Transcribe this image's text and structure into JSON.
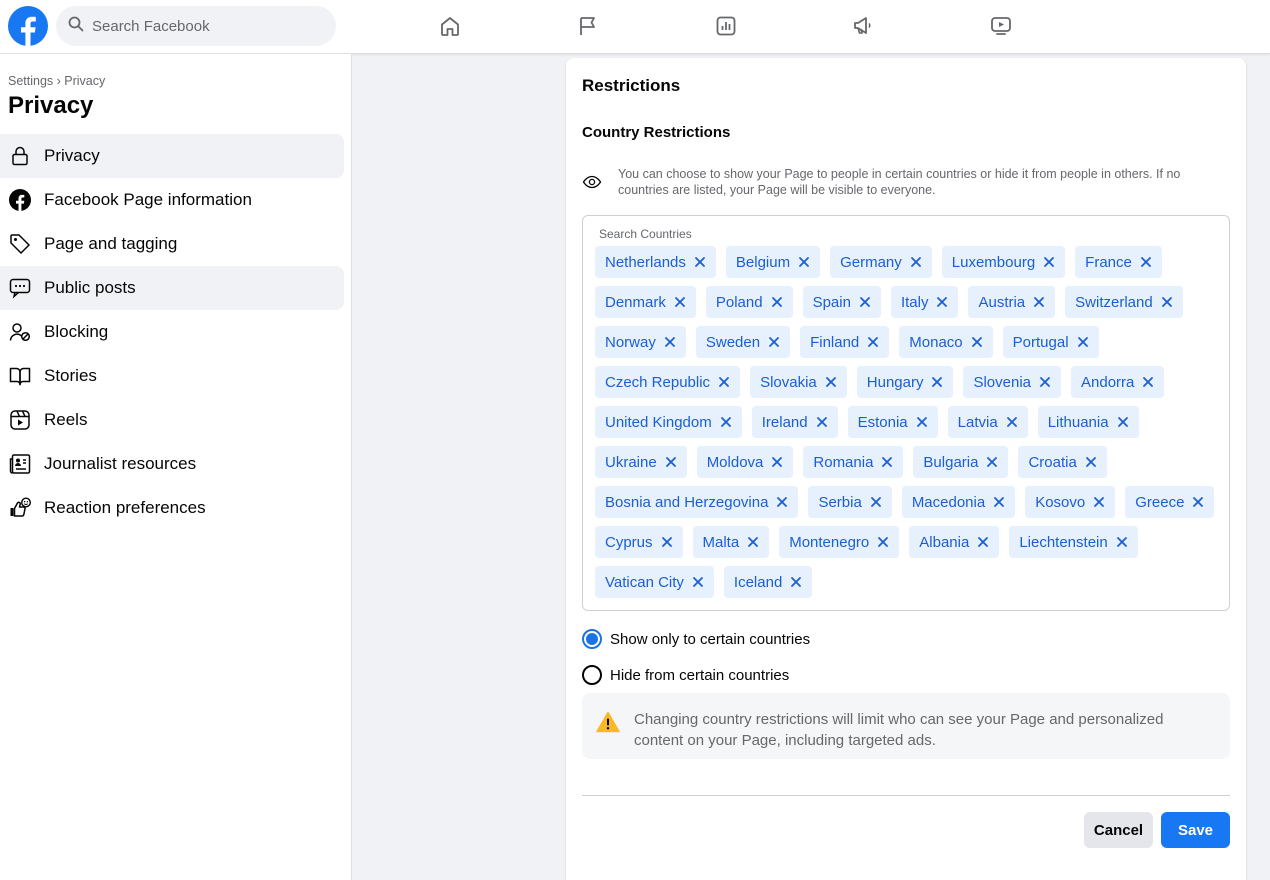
{
  "topbar": {
    "search_placeholder": "Search Facebook",
    "nav_icons": [
      "home-icon",
      "flag-icon",
      "insights-icon",
      "megaphone-icon",
      "video-icon"
    ]
  },
  "sidebar": {
    "breadcrumb": "Settings › Privacy",
    "title": "Privacy",
    "items": [
      {
        "label": "Privacy",
        "icon": "lock-icon",
        "active": true
      },
      {
        "label": "Facebook Page information",
        "icon": "facebook-icon",
        "active": false
      },
      {
        "label": "Page and tagging",
        "icon": "tag-icon",
        "active": false
      },
      {
        "label": "Public posts",
        "icon": "public-posts-icon",
        "active": true
      },
      {
        "label": "Blocking",
        "icon": "block-user-icon",
        "active": false
      },
      {
        "label": "Stories",
        "icon": "book-icon",
        "active": false
      },
      {
        "label": "Reels",
        "icon": "reels-icon",
        "active": false
      },
      {
        "label": "Journalist resources",
        "icon": "news-icon",
        "active": false
      },
      {
        "label": "Reaction preferences",
        "icon": "reactions-icon",
        "active": false
      }
    ]
  },
  "main": {
    "title": "Restrictions",
    "section_title": "Country Restrictions",
    "info_text": "You can choose to show your Page to people in certain countries or hide it from people in others. If no countries are listed, your Page will be visible to everyone.",
    "search_label": "Search Countries",
    "countries": [
      "Netherlands",
      "Belgium",
      "Germany",
      "Luxembourg",
      "France",
      "Denmark",
      "Poland",
      "Spain",
      "Italy",
      "Austria",
      "Switzerland",
      "Norway",
      "Sweden",
      "Finland",
      "Monaco",
      "Portugal",
      "Czech Republic",
      "Slovakia",
      "Hungary",
      "Slovenia",
      "Andorra",
      "United Kingdom",
      "Ireland",
      "Estonia",
      "Latvia",
      "Lithuania",
      "Ukraine",
      "Moldova",
      "Romania",
      "Bulgaria",
      "Croatia",
      "Bosnia and Herzegovina",
      "Serbia",
      "Macedonia",
      "Kosovo",
      "Greece",
      "Cyprus",
      "Malta",
      "Montenegro",
      "Albania",
      "Liechtenstein",
      "Vatican City",
      "Iceland"
    ],
    "radio_show": "Show only to certain countries",
    "radio_hide": "Hide from certain countries",
    "selected_option": "show",
    "warning_text": "Changing country restrictions will limit who can see your Page and personalized content on your Page, including targeted ads.",
    "cancel_label": "Cancel",
    "save_label": "Save"
  },
  "colors": {
    "brand": "#1877f2",
    "tag_bg": "#e7f0fd",
    "tag_text": "#1b5fd1",
    "warning": "#f7b928"
  }
}
